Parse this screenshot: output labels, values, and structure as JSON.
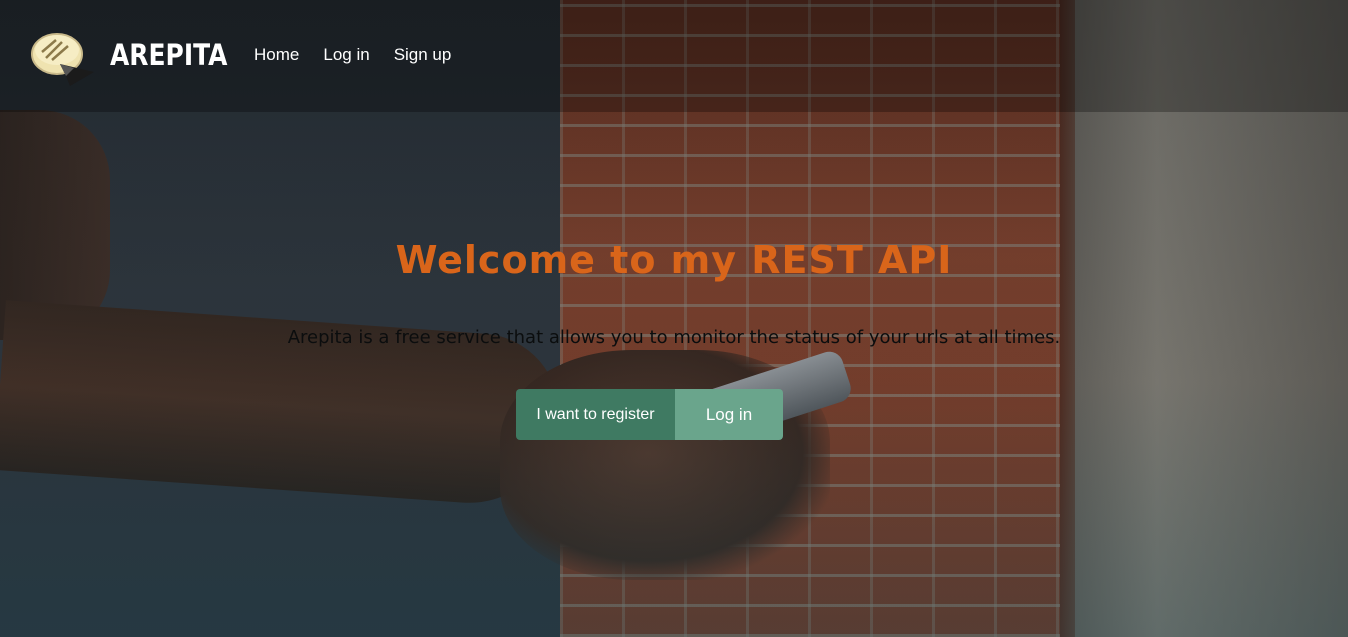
{
  "navbar": {
    "brand": "AREPITA",
    "links": [
      {
        "label": "Home"
      },
      {
        "label": "Log in"
      },
      {
        "label": "Sign up"
      }
    ],
    "logo_icon": "arepa-logo-icon"
  },
  "hero": {
    "title": "Welcome to my REST API",
    "subtitle": "Arepita is a free service that allows you to monitor the status of your urls at all times.",
    "register_button": "I want to register",
    "login_button": "Log in"
  },
  "colors": {
    "title": "#d9651a",
    "register_button": "#3f7a62",
    "login_button": "#6aa58c"
  }
}
